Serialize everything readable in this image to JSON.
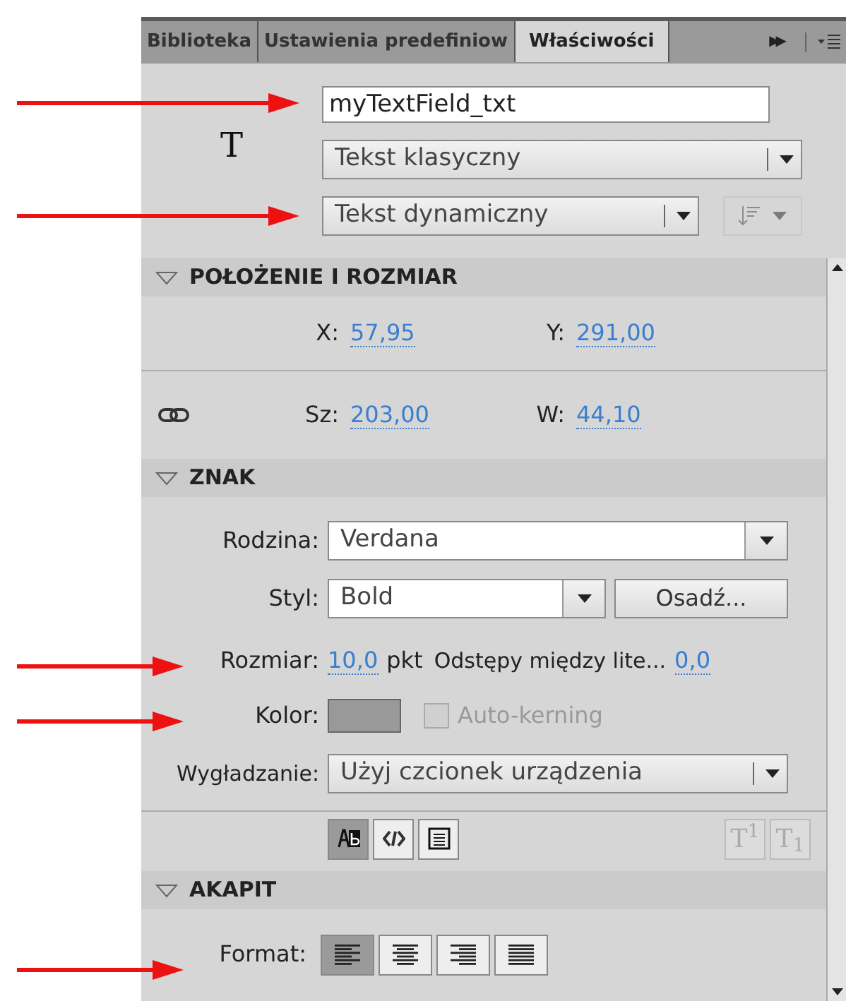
{
  "tabs": [
    {
      "label": "Biblioteka",
      "selected": false
    },
    {
      "label": "Ustawienia predefiniow",
      "selected": false
    },
    {
      "label": "Właściwości",
      "selected": true
    }
  ],
  "tab_overflow": "▶▶",
  "type_icon": "T",
  "instance_name": {
    "value": "myTextField_txt"
  },
  "engine_dropdown": {
    "value": "Tekst klasyczny"
  },
  "text_type_dropdown": {
    "value": "Tekst dynamiczny"
  },
  "sections": [
    {
      "title": "POŁOŻENIE I ROZMIAR",
      "expanded": true
    },
    {
      "title": "ZNAK",
      "expanded": true
    },
    {
      "title": "AKAPIT",
      "expanded": true
    }
  ],
  "position": [
    {
      "label": "X:",
      "value": "57,95"
    },
    {
      "label": "Y:",
      "value": "291,00"
    }
  ],
  "size": [
    {
      "label": "Sz:",
      "value": "203,00"
    },
    {
      "label": "W:",
      "value": "44,10"
    }
  ],
  "character": {
    "family_label": "Rodzina:",
    "family": "Verdana",
    "style_label": "Styl:",
    "style": "Bold",
    "embed_button": "Osadź...",
    "size_label": "Rozmiar:",
    "size": "10,0",
    "size_unit": "pkt",
    "spacing_label": "Odstępy między lite...",
    "spacing": "0,0",
    "color_label": "Kolor:",
    "color": "#999999",
    "kerning": {
      "label": "Auto-kerning",
      "checked": false,
      "disabled": true
    },
    "antialias_label": "Wygładzanie:",
    "antialias": "Użyj czcionek urządzenia"
  },
  "text_options": [
    {
      "kind": "selectable",
      "selected": true
    },
    {
      "kind": "html",
      "selected": false
    },
    {
      "kind": "border",
      "selected": false
    }
  ],
  "script_buttons": [
    {
      "label": "T$^{1}$",
      "disabled": true
    },
    {
      "label": "T$_{1}$",
      "disabled": true
    }
  ],
  "paragraph": {
    "format_label": "Format:",
    "align": [
      {
        "kind": "left",
        "selected": true
      },
      {
        "kind": "center",
        "selected": false
      },
      {
        "kind": "right",
        "selected": false
      },
      {
        "kind": "justify",
        "selected": false
      }
    ]
  }
}
